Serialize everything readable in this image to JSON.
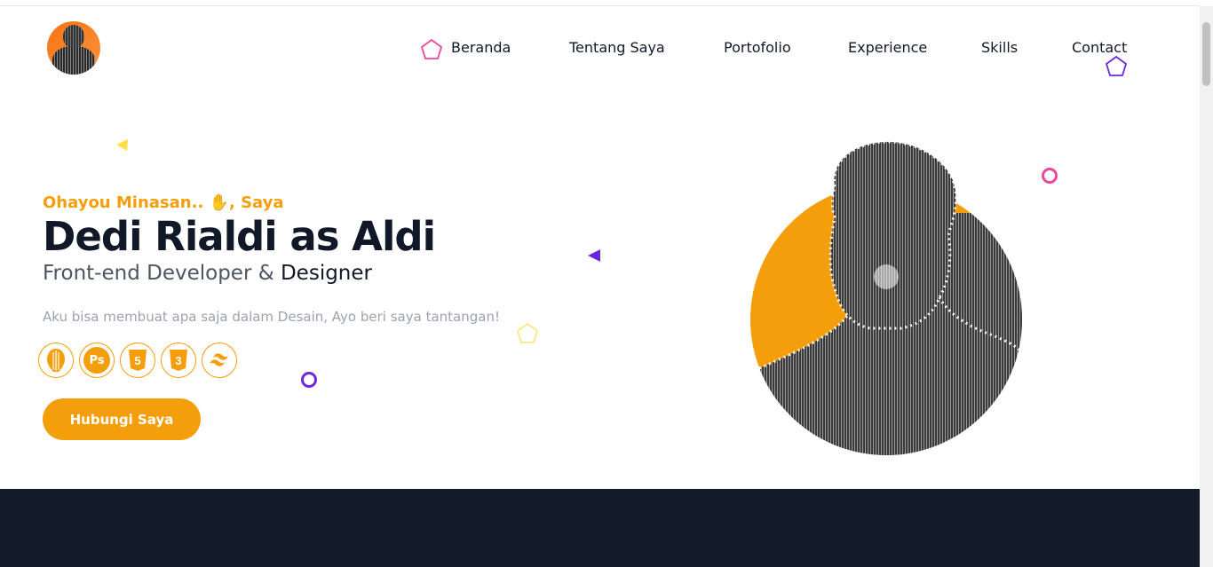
{
  "nav": {
    "items": [
      "Beranda",
      "Tentang Saya",
      "Portofolio",
      "Experience",
      "Skills",
      "Contact"
    ]
  },
  "hero": {
    "greeting_prefix": "Ohayou Minasan.. ",
    "greeting_suffix": ", Saya",
    "name": "Dedi Rialdi as Aldi",
    "role_prefix": "Front-end Developer & ",
    "role_highlight": "Designer",
    "description": "Aku bisa membuat apa saja dalam Desain, Ayo beri saya tantangan!",
    "skill_icons": [
      "illustrator-icon",
      "photoshop-icon",
      "html5-icon",
      "css3-icon",
      "tailwind-icon"
    ],
    "skill_labels": [
      "",
      "Ps",
      "5",
      "3",
      ""
    ],
    "cta_label": "Hubungi Saya"
  },
  "colors": {
    "accent": "#f59e0b",
    "dark": "#131a2a",
    "pink": "#ec4899",
    "purple": "#6d28d9",
    "yellow": "#fde047"
  }
}
